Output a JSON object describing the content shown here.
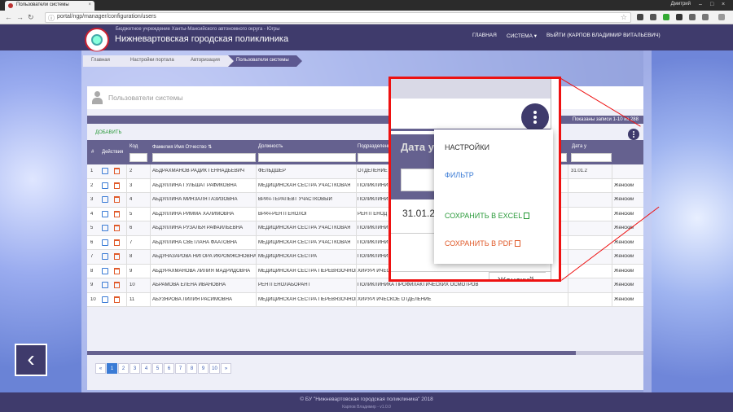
{
  "browser": {
    "tab_title": "Пользователи системы",
    "tab_close": "×",
    "url": "portal/ngp/manager/configuration/users",
    "user": "Дмитрий",
    "minimize": "–",
    "maximize": "□",
    "close": "×"
  },
  "header": {
    "org": "Бюджетное учреждение Ханты-Мансийского автономного округа - Югры",
    "clinic": "Нижневартовская городская поликлиника",
    "nav": [
      "ГЛАВНАЯ",
      "СИСТЕМА ▾",
      "ВЫЙТИ (КАРПОВ ВЛАДИМИР ВИТАЛЬЕВИЧ)"
    ]
  },
  "breadcrumbs": [
    "Главная",
    "Настройки портала",
    "Авторизация",
    "Пользователи системы"
  ],
  "panel": {
    "title": "Пользователи системы",
    "shown": "Показаны записи 1-10 из 288",
    "add": "ДОБАВИТЬ"
  },
  "table": {
    "headers": [
      "#",
      "Действия",
      "Код",
      "Фамилия Имя Отчество ⇅",
      "Должность",
      "Подразделение",
      "",
      "Дата у"
    ],
    "rows": [
      {
        "n": "1",
        "code": "2",
        "fio": "АБДРАХМАНОВ РАДИК ГЕННАДЬЕВИЧ",
        "pos": "ФЕЛЬДШЕР",
        "dept": "ОТДЕЛЕНИЕ",
        "date": "31.01.2",
        "gender": ""
      },
      {
        "n": "2",
        "code": "3",
        "fio": "АБДУЛЛИНА ГУЛЬШАТ РАФИКОВНА",
        "pos": "МЕДИЦИНСКАЯ СЕСТРА УЧАСТКОВАЯ",
        "dept": "ПОЛИКЛИНИ",
        "date": "",
        "gender": "Женский"
      },
      {
        "n": "3",
        "code": "4",
        "fio": "АБДУЛЛИНА МИНЗАЛЯ ГАЗИЗОВНА",
        "pos": "ВРАЧ-ТЕРАПЕВТ УЧАСТКОВЫЙ",
        "dept": "ПОЛИКЛИНИ",
        "date": "",
        "gender": "Женский"
      },
      {
        "n": "4",
        "code": "5",
        "fio": "АБДУЛЛИНА РИММА ХАЛИМОВНА",
        "pos": "ВРАЧ-РЕНТГЕНОЛОГ",
        "dept": "РЕНТГЕНОД",
        "date": "",
        "gender": "Женский"
      },
      {
        "n": "5",
        "code": "6",
        "fio": "АБДУЛЛИНА РУЗАЛЬЯ РАФАИЛЬЕВНА",
        "pos": "МЕДИЦИНСКАЯ СЕСТРА УЧАСТКОВАЯ",
        "dept": "ПОЛИКЛИНИ",
        "date": "",
        "gender": "Женский"
      },
      {
        "n": "6",
        "code": "7",
        "fio": "АБДУЛЛИНА СВЕТЛАНА ФААТОВНА",
        "pos": "МЕДИЦИНСКАЯ СЕСТРА УЧАСТКОВАЯ",
        "dept": "ПОЛИКЛИНИ",
        "date": "",
        "gender": "Женский"
      },
      {
        "n": "7",
        "code": "8",
        "fio": "АБДУНАЗАРОВА НИГОРА ИКРОМЖОНОВНА",
        "pos": "МЕДИЦИНСКАЯ СЕСТРА",
        "dept": "ПОЛИКЛИНИ",
        "date": "",
        "gender": "Женский"
      },
      {
        "n": "8",
        "code": "9",
        "fio": "АБДУРАХМАНОВА ЛИЛИЯ МАДРИДОВНА",
        "pos": "МЕДИЦИНСКАЯ СЕСТРА ПЕРЕВЯЗОЧНОЙ",
        "dept": "ХИРУРГИЧЕСКОЕ ОТДЕЛЕНИЕ",
        "date": "",
        "gender": "Женский"
      },
      {
        "n": "9",
        "code": "10",
        "fio": "АБРАМОВА ЕЛЕНА ИВАНОВНА",
        "pos": "РЕНТГЕНОЛАБОРАНТ",
        "dept": "ПОЛИКЛИНИКА ПРОФИЛАКТИЧЕСКИХ ОСМОТРОВ",
        "date": "",
        "gender": "Женский"
      },
      {
        "n": "10",
        "code": "11",
        "fio": "АБУЗЯРОВА ЛИЛИЯ РАСИМОВНА",
        "pos": "МЕДИЦИНСКАЯ СЕСТРА ПЕРЕВЯЗОЧНОЙ",
        "dept": "ХИРУРГИЧЕСКОЕ ОТДЕЛЕНИЕ",
        "date": "",
        "gender": "Женский"
      }
    ]
  },
  "pager": [
    "«",
    "1",
    "2",
    "3",
    "4",
    "5",
    "6",
    "7",
    "8",
    "9",
    "10",
    "»"
  ],
  "pager_active": "1",
  "menu": {
    "settings": "НАСТРОЙКИ",
    "filter": "ФИЛЬТР",
    "excel": "СОХРАНИТЬ В EXCEL",
    "pdf": "СОХРАНИТЬ В PDF"
  },
  "zoom": {
    "col_header": "Дата у",
    "date": "31.01.2",
    "gender": "Женский"
  },
  "footer": {
    "copyright": "© БУ \"Нижневартовская городская поликлиника\" 2018",
    "version": "Карпов Владимир - v1.0.0"
  },
  "icons": {
    "back": "‹",
    "info": "ⓘ",
    "star": "☆",
    "excel_icon": "excel-file-icon",
    "pdf_icon": "pdf-file-icon"
  },
  "colors": {
    "header": "#3f3b6c",
    "grid_header": "#65618f",
    "add": "#2a9a3a",
    "excel": "#2a9a3a",
    "pdf": "#e05a2a",
    "filter": "#3a7bd5",
    "callout": "#e11111"
  }
}
